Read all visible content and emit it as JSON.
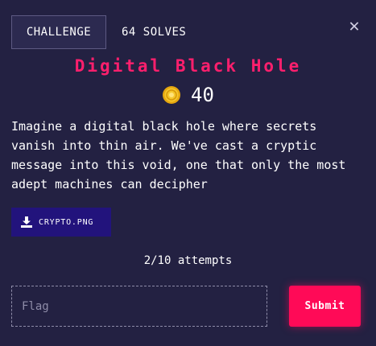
{
  "tabs": {
    "challenge_label": "CHALLENGE",
    "solves_label": "64 SOLVES"
  },
  "close": {
    "icon": "close-icon",
    "glyph": "✕"
  },
  "challenge": {
    "title": "Digital Black Hole",
    "value": "40",
    "value_icon": "coin-icon",
    "description": "Imagine a digital black hole where secrets vanish into thin air. We've cast a cryptic message into this void, one that only the most adept machines can decipher",
    "file": {
      "label": "CRYPTO.PNG",
      "icon": "download-icon"
    },
    "attempts": "2/10 attempts"
  },
  "form": {
    "flag_placeholder": "Flag",
    "flag_value": "",
    "submit_label": "Submit"
  },
  "colors": {
    "background": "#232142",
    "title": "#ff1f6d",
    "submit": "#ff0a57",
    "file_button": "#22137c",
    "coin": "#f0c419"
  }
}
